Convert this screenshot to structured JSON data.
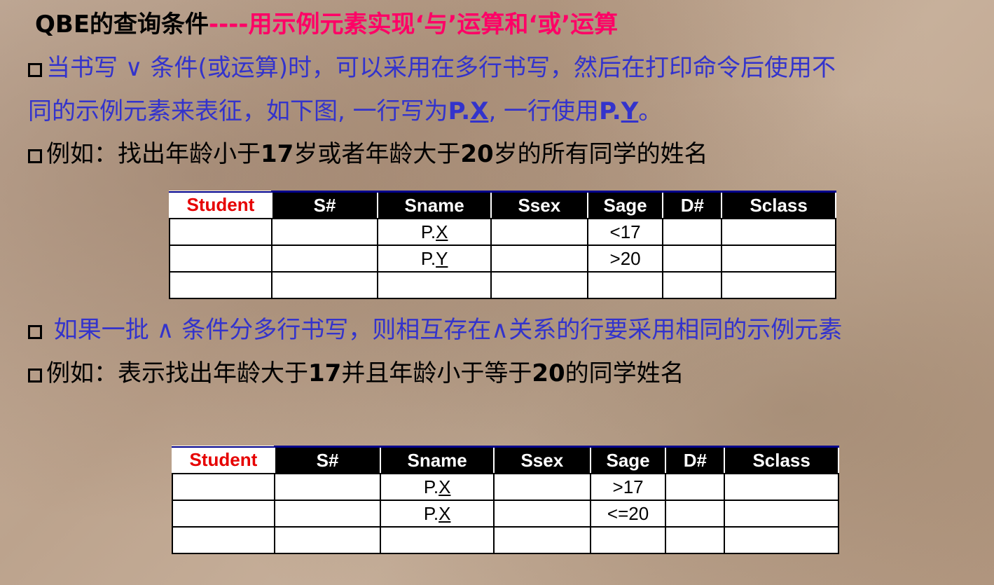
{
  "title": {
    "part1": "QBE的查询条件",
    "part2": "----用示例元素实现‘与’运算和‘或’运算"
  },
  "para1": {
    "l1": "当书写 ∨ 条件(或运算)时，可以采用在多行书写，然后在打印命令后使用不",
    "l2a": "同的示例元素来表征，如下图, 一行写为",
    "l2b": "P.",
    "l2c": "X",
    "l2d": ", 一行使用",
    "l2e": "P.",
    "l2f": "Y",
    "l2g": "。"
  },
  "ex1": {
    "a": "例如：找出年龄小于",
    "b": "17",
    "c": "岁或者年龄大于",
    "d": "20",
    "e": "岁的所有同学的姓名"
  },
  "table1": {
    "headers": [
      "Student",
      "S#",
      "Sname",
      "Ssex",
      "Sage",
      "D#",
      "Sclass"
    ],
    "rows": [
      {
        "sname_p": "P.",
        "sname_x": "X",
        "sage": "<17"
      },
      {
        "sname_p": "P.",
        "sname_x": "Y",
        "sage": ">20"
      }
    ]
  },
  "para2": {
    "text": " 如果一批 ∧ 条件分多行书写，则相互存在∧关系的行要采用相同的示例元素"
  },
  "ex2": {
    "a": "例如：表示找出年龄大于",
    "b": "17",
    "c": "并且年龄小于等于",
    "d": "20",
    "e": "的同学姓名"
  },
  "table2": {
    "headers": [
      "Student",
      "S#",
      "Sname",
      "Ssex",
      "Sage",
      "D#",
      "Sclass"
    ],
    "rows": [
      {
        "sname_p": "P.",
        "sname_x": "X",
        "sage": ">17"
      },
      {
        "sname_p": "P.",
        "sname_x": "X",
        "sage": "<=20"
      }
    ]
  }
}
